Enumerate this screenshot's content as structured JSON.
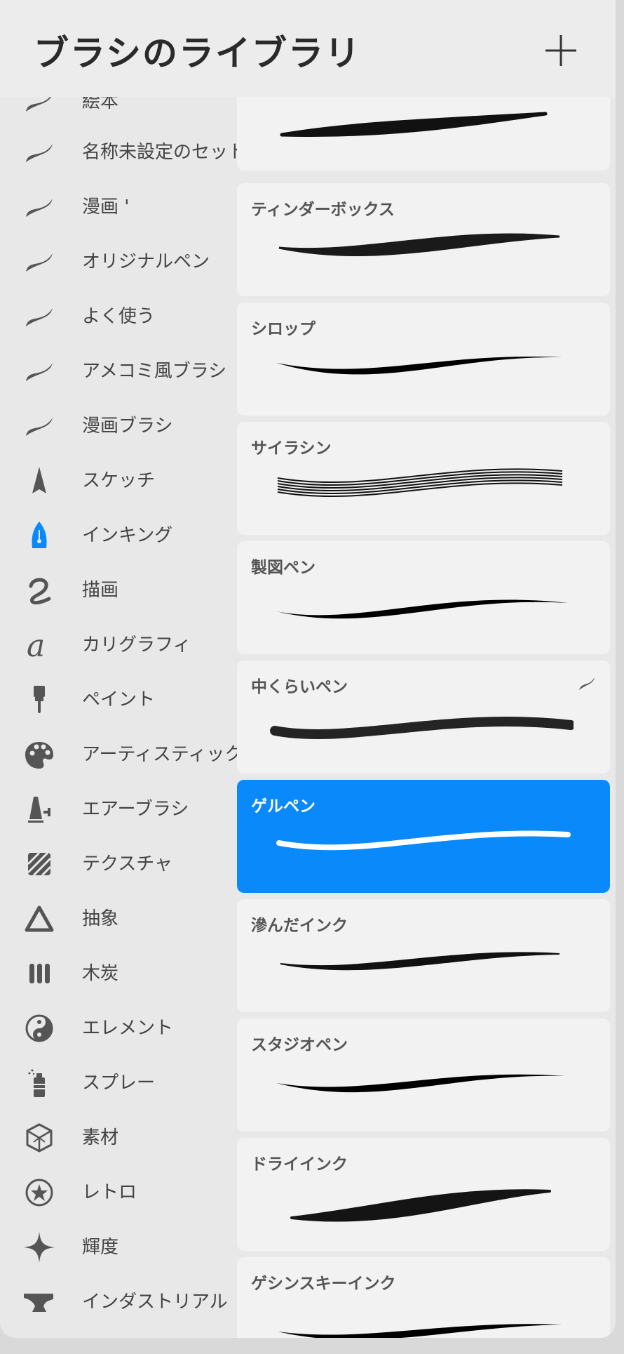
{
  "header": {
    "title": "ブラシのライブラリ"
  },
  "sidebar": {
    "items": [
      {
        "label": "絵本",
        "icon": "brush-stroke-icon"
      },
      {
        "label": "名称未設定のセット",
        "icon": "brush-stroke-icon"
      },
      {
        "label": "漫画 '",
        "icon": "brush-stroke-icon"
      },
      {
        "label": "オリジナルペン",
        "icon": "brush-stroke-icon"
      },
      {
        "label": "よく使う",
        "icon": "brush-stroke-icon"
      },
      {
        "label": "アメコミ風ブラシ",
        "icon": "brush-stroke-icon"
      },
      {
        "label": "漫画ブラシ",
        "icon": "brush-stroke-icon"
      },
      {
        "label": "スケッチ",
        "icon": "pencil-tip-icon"
      },
      {
        "label": "インキング",
        "icon": "fountain-pen-icon"
      },
      {
        "label": "描画",
        "icon": "squiggle-icon"
      },
      {
        "label": "カリグラフィ",
        "icon": "calligraphy-a-icon"
      },
      {
        "label": "ペイント",
        "icon": "paintbrush-icon"
      },
      {
        "label": "アーティスティック",
        "icon": "palette-icon"
      },
      {
        "label": "エアーブラシ",
        "icon": "airbrush-icon"
      },
      {
        "label": "テクスチャ",
        "icon": "texture-hatch-icon"
      },
      {
        "label": "抽象",
        "icon": "triangle-icon"
      },
      {
        "label": "木炭",
        "icon": "charcoal-sticks-icon"
      },
      {
        "label": "エレメント",
        "icon": "yin-yang-icon"
      },
      {
        "label": "スプレー",
        "icon": "spray-can-icon"
      },
      {
        "label": "素材",
        "icon": "cube-icon"
      },
      {
        "label": "レトロ",
        "icon": "star-circle-icon"
      },
      {
        "label": "輝度",
        "icon": "sparkle-icon"
      },
      {
        "label": "インダストリアル",
        "icon": "anvil-icon"
      }
    ]
  },
  "brushes": [
    {
      "name": "",
      "selected": false
    },
    {
      "name": "ティンダーボックス",
      "selected": false
    },
    {
      "name": "シロップ",
      "selected": false
    },
    {
      "name": "サイラシン",
      "selected": false
    },
    {
      "name": "製図ペン",
      "selected": false
    },
    {
      "name": "中くらいペン",
      "selected": false
    },
    {
      "name": "ゲルペン",
      "selected": true
    },
    {
      "name": "滲んだインク",
      "selected": false
    },
    {
      "name": "スタジオペン",
      "selected": false
    },
    {
      "name": "ドライインク",
      "selected": false
    },
    {
      "name": "ゲシンスキーインク",
      "selected": false
    }
  ],
  "colors": {
    "accent": "#0a89fb",
    "text": "#444444",
    "card": "#f2f2f2"
  }
}
